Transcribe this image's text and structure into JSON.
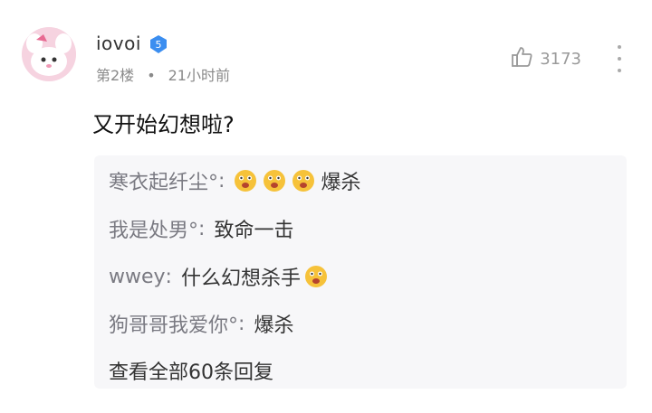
{
  "post": {
    "username": "iovoi",
    "badge_level": "5",
    "floor": "第2楼",
    "dot": "•",
    "time": "21小时前",
    "likes": "3173",
    "comment": "又开始幻想啦?"
  },
  "replies": {
    "items": [
      {
        "author": "寒衣起纤尘°",
        "sep": ":",
        "emojis": 3,
        "text": "爆杀"
      },
      {
        "author": "我是处男°",
        "sep": ":",
        "emojis": 0,
        "text": "致命一击"
      },
      {
        "author": "wwey",
        "sep": ":",
        "emojis_after": 1,
        "text": "什么幻想杀手"
      },
      {
        "author": "狗哥哥我爱你°",
        "sep": ":",
        "emojis": 0,
        "text": "爆杀"
      }
    ],
    "view_all": "查看全部60条回复"
  },
  "colors": {
    "accent": "#3b8ef0",
    "muted": "#8a8a8a",
    "reply_bg": "#f7f7f9"
  },
  "icons": [
    "avatar",
    "verified-badge-icon",
    "thumbs-up-icon",
    "more-icon",
    "emoji-icon"
  ]
}
